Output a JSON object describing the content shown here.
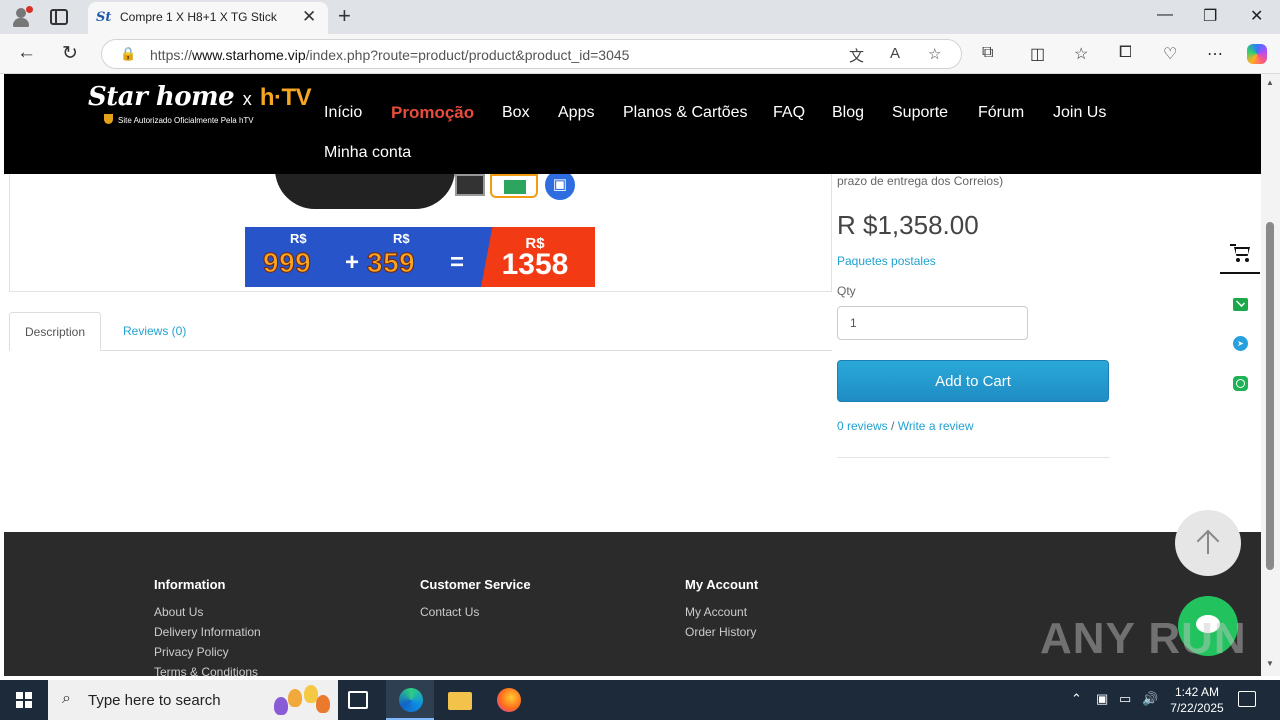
{
  "browser": {
    "tab_title": "Compre 1 X H8+1 X TG Stick",
    "tab_favicon": "St",
    "url_prefix": "https://",
    "url_domain": "www.starhome.vip",
    "url_path": "/index.php?route=product/product&product_id=3045"
  },
  "header": {
    "logo_main": "Star home",
    "logo_x": "x",
    "logo_brand": "h·TV",
    "logo_tagline": "Site Autorizado Oficialmente Pela hTV",
    "menu": [
      "Início",
      "Promoção",
      "Box",
      "Apps",
      "Planos & Cartões",
      "FAQ",
      "Blog",
      "Suporte",
      "Fórum",
      "Join Us",
      "Minha conta"
    ]
  },
  "product_image": {
    "currency": "R$",
    "price_a": "999",
    "plus": "+",
    "price_b": "359",
    "equals": "=",
    "price_total": "1358"
  },
  "product": {
    "delivery_note": "prazo de entrega dos Correios)",
    "price": "R $1,358.00",
    "shipping": "Paquetes postales",
    "qty_label": "Qty",
    "qty_value": "1",
    "add_to_cart": "Add to Cart",
    "reviews_link": "0 reviews",
    "separator": " / ",
    "write_review": "Write a review"
  },
  "tabs": {
    "description": "Description",
    "reviews": "Reviews (0)"
  },
  "footer": {
    "information": {
      "title": "Information",
      "links": [
        "About Us",
        "Delivery Information",
        "Privacy Policy",
        "Terms & Conditions"
      ]
    },
    "customer_service": {
      "title": "Customer Service",
      "links": [
        "Contact Us"
      ]
    },
    "my_account": {
      "title": "My Account",
      "links": [
        "My Account",
        "Order History"
      ]
    }
  },
  "watermark": "ANY RUN",
  "taskbar": {
    "search_placeholder": "Type here to search",
    "time": "1:42 AM",
    "date": "7/22/2025"
  },
  "colors": {
    "header_bg": "#000000",
    "promo": "#e74c3c",
    "link": "#23a1d1",
    "cart_button": "#1f8dc4",
    "footer_bg": "#2b2b2b"
  }
}
